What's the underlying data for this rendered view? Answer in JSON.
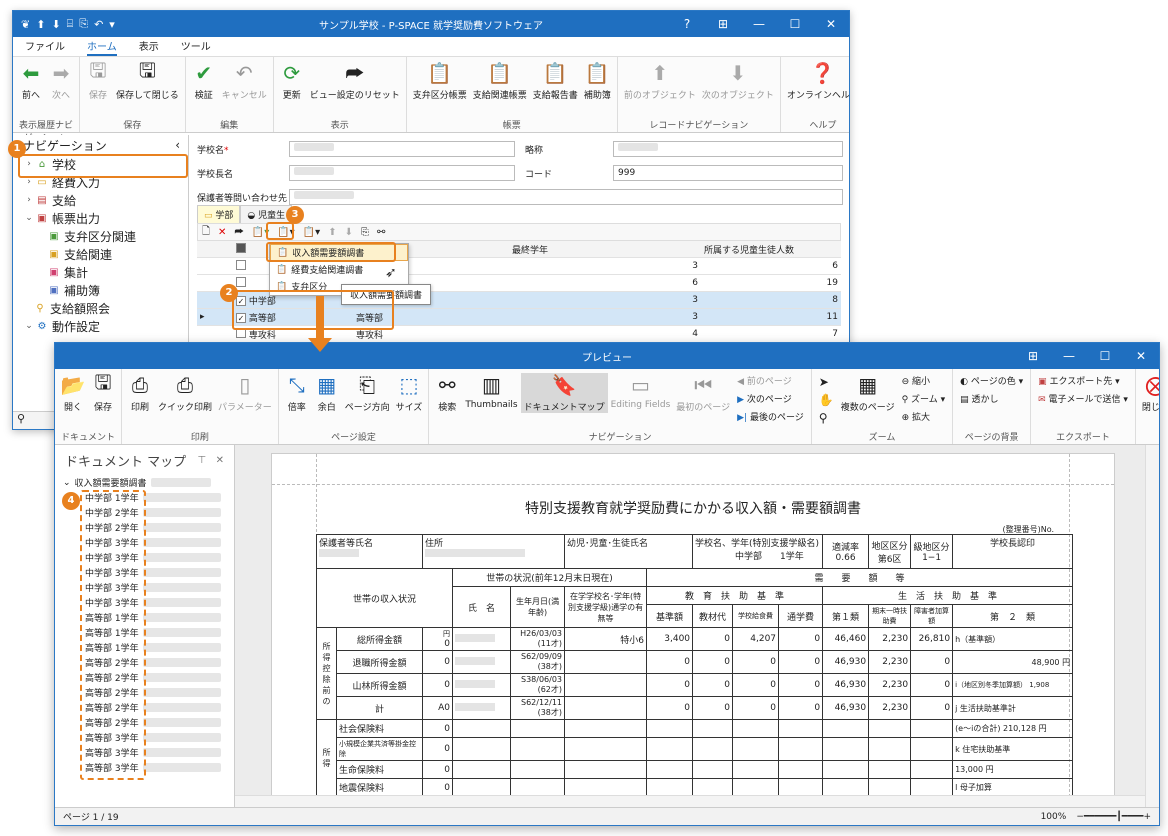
{
  "back": {
    "title": "サンプル学校 - P-SPACE 就学奨励費ソフトウェア",
    "menu": [
      "ファイル",
      "ホーム",
      "表示",
      "ツール"
    ],
    "ribbon_groups": [
      {
        "label": "表示履歴ナビゲーション",
        "buttons": [
          "前へ",
          "次へ"
        ]
      },
      {
        "label": "保存",
        "buttons": [
          "保存",
          "保存して閉じる"
        ]
      },
      {
        "label": "編集",
        "buttons": [
          "検証",
          "キャンセル"
        ]
      },
      {
        "label": "表示",
        "buttons": [
          "更新",
          "ビュー設定のリセット"
        ]
      },
      {
        "label": "帳票",
        "buttons": [
          "支弁区分帳票",
          "支給関連帳票",
          "支給報告書",
          "補助簿"
        ]
      },
      {
        "label": "レコードナビゲーション",
        "buttons": [
          "前のオブジェクト",
          "次のオブジェクト"
        ]
      },
      {
        "label": "ヘルプ",
        "buttons": [
          "オンラインヘルプ"
        ]
      }
    ],
    "nav": {
      "header": "ナビゲーション",
      "items": [
        {
          "label": "学校",
          "icon": "school-icon"
        },
        {
          "label": "経費入力",
          "icon": "folder-icon"
        },
        {
          "label": "支給",
          "icon": "table-icon"
        },
        {
          "label": "帳票出力",
          "icon": "report-icon"
        },
        {
          "label": "支弁区分関連",
          "icon": "report-icon"
        },
        {
          "label": "支給関連",
          "icon": "report-icon"
        },
        {
          "label": "集計",
          "icon": "report-icon"
        },
        {
          "label": "補助簿",
          "icon": "report-icon"
        },
        {
          "label": "支給額照会",
          "icon": "search-icon"
        },
        {
          "label": "動作設定",
          "icon": "gear-icon"
        }
      ]
    },
    "form": {
      "school_name_label": "学校名",
      "required_mark": "*",
      "short_name_label": "略称",
      "school_head_label": "学校長名",
      "code_label": "コード",
      "code_value": "999",
      "contact_label": "保護者等問い合わせ先"
    },
    "tabs": [
      "学部",
      "児童生"
    ],
    "grid": {
      "headers": [
        "学部区分",
        "最終学年",
        "所属する児童生徒人数"
      ],
      "rows": [
        {
          "name": "",
          "dept": "幼稚部",
          "last": "3",
          "count": "6",
          "checked": false,
          "selected": false
        },
        {
          "name": "",
          "dept": "部",
          "last": "6",
          "count": "19",
          "checked": false,
          "selected": false
        },
        {
          "name": "中学部",
          "dept": "中学部",
          "last": "3",
          "count": "8",
          "checked": true,
          "selected": true
        },
        {
          "name": "高等部",
          "dept": "高等部",
          "last": "3",
          "count": "11",
          "checked": true,
          "selected": true
        },
        {
          "name": "専攻科",
          "dept": "専攻科",
          "last": "4",
          "count": "7",
          "checked": false,
          "selected": false
        }
      ]
    },
    "dropdown": [
      "収入額需要額調書",
      "経費支給関連調書",
      "支弁区分"
    ],
    "tooltip": "収入額需要額調書"
  },
  "preview": {
    "title": "プレビュー",
    "ribbon_groups": [
      {
        "label": "ドキュメント",
        "buttons": [
          "開く",
          "保存"
        ]
      },
      {
        "label": "印刷",
        "buttons": [
          "印刷",
          "クイック印刷",
          "パラメーター"
        ]
      },
      {
        "label": "ページ設定",
        "buttons": [
          "倍率",
          "余白",
          "ページ方向",
          "サイズ"
        ]
      },
      {
        "label": "ナビゲーション",
        "buttons": [
          "検索",
          "Thumbnails",
          "ドキュメントマップ",
          "Editing Fields",
          "最初のページ"
        ],
        "small": [
          "前のページ",
          "次のページ",
          "最後のページ"
        ]
      },
      {
        "label": "ズーム",
        "buttons": [
          "複数のページ"
        ],
        "small": [
          "縮小",
          "ズーム",
          "拡大"
        ]
      },
      {
        "label": "ページの背景",
        "small": [
          "ページの色",
          "透かし"
        ]
      },
      {
        "label": "エクスポート",
        "small": [
          "エクスポート先",
          "電子メールで送信"
        ]
      },
      {
        "label": "",
        "buttons": [
          "閉じる"
        ]
      }
    ],
    "docmap": {
      "title": "ドキュメント マップ",
      "root": "収入額需要額調書",
      "items": [
        "中学部 1学年",
        "中学部 2学年",
        "中学部 2学年",
        "中学部 3学年",
        "中学部 3学年",
        "中学部 3学年",
        "中学部 3学年",
        "中学部 3学年",
        "高等部 1学年",
        "高等部 1学年",
        "高等部 1学年",
        "高等部 2学年",
        "高等部 2学年",
        "高等部 2学年",
        "高等部 2学年",
        "高等部 2学年",
        "高等部 3学年",
        "高等部 3学年",
        "高等部 3学年"
      ]
    },
    "status": {
      "page": "ページ 1 / 19",
      "zoom": "100%"
    },
    "report": {
      "title": "特別支援教育就学奨励費にかかる収入額・需要額調書",
      "seiri": "(整理番号)No.",
      "h_guardian": "保護者等氏名",
      "h_address": "住所",
      "h_child": "幼児･児童･生徒氏名",
      "h_school": "学校名、学年(特別支援学級名)",
      "h_rate": "適減率",
      "h_area": "地区区分",
      "h_area2": "級地区分",
      "h_principal": "学校長認印",
      "school_grade": "中学部　　1学年",
      "rate": "0.66",
      "area": "第6区",
      "area2": "1−1",
      "h_household": "世帯の状況(前年12月末日現在)",
      "h_demand": "需　　要　　額　　等",
      "h_income_status": "世帯の収入状況",
      "h_name": "氏　名",
      "h_birth": "生年月日(満年齢)",
      "h_enroll": "在学学校名･学年(特別支援学級)通学の有無等",
      "h_edu": "教　育　扶　助　基　準",
      "h_life": "生　活　扶　助　基　準",
      "h_base": "基準額",
      "h_material": "教材代",
      "h_lunch": "学校給食費",
      "h_commute": "通学費",
      "h_type1": "第１類",
      "h_yearend": "期末一時扶助費",
      "h_disab": "障害者加算額",
      "h_type2": "第　２　類",
      "unit": "円",
      "income_rows": [
        {
          "label": "総所得金額",
          "value": "0",
          "birth": "H26/03/03",
          "age": "(11才)",
          "note": "特小6",
          "base": "3,400",
          "material": "0",
          "lunch": "4,207",
          "commute": "0",
          "t1": "46,460",
          "ye": "2,230",
          "dis": "26,810"
        },
        {
          "label": "退職所得金額",
          "value": "0",
          "birth": "S62/09/09",
          "age": "(38才)",
          "note": "",
          "base": "0",
          "material": "0",
          "lunch": "0",
          "commute": "0",
          "t1": "46,930",
          "ye": "2,230",
          "dis": "0"
        },
        {
          "label": "山林所得金額",
          "value": "0",
          "birth": "S38/06/03",
          "age": "(62才)",
          "note": "",
          "base": "0",
          "material": "0",
          "lunch": "0",
          "commute": "0",
          "t1": "46,930",
          "ye": "2,230",
          "dis": "0"
        },
        {
          "label": "計",
          "value": "0",
          "birth": "S62/12/11",
          "age": "(38才)",
          "note": "",
          "base": "0",
          "material": "0",
          "lunch": "0",
          "commute": "0",
          "t1": "46,930",
          "ye": "2,230",
          "dis": "0"
        }
      ],
      "total_mark": "A",
      "side_label_1": "所得控除前の",
      "side_label_2": "所得",
      "deduct_rows": [
        {
          "label": "社会保険料",
          "value": "0"
        },
        {
          "label": "小規模企業共済等掛金控除",
          "value": "0"
        },
        {
          "label": "生命保険料",
          "value": "0"
        },
        {
          "label": "地震保険料",
          "value": "0"
        }
      ],
      "right_h": "h（基準額）",
      "right_h_val": "48,900",
      "right_i": "i（地区別冬季加算額）",
      "right_i_val": "1,908",
      "right_j": "j 生活扶助基準計",
      "right_j_sub": "(e〜iの合計)",
      "right_j_val": "210,128",
      "right_k": "k 住宅扶助基準",
      "right_k_val": "13,000",
      "right_l": "l 母子加算"
    }
  },
  "callouts": [
    "1",
    "2",
    "3",
    "4"
  ],
  "colors": {
    "titlebar": "#1f6fc0",
    "accent": "#e8811f"
  }
}
